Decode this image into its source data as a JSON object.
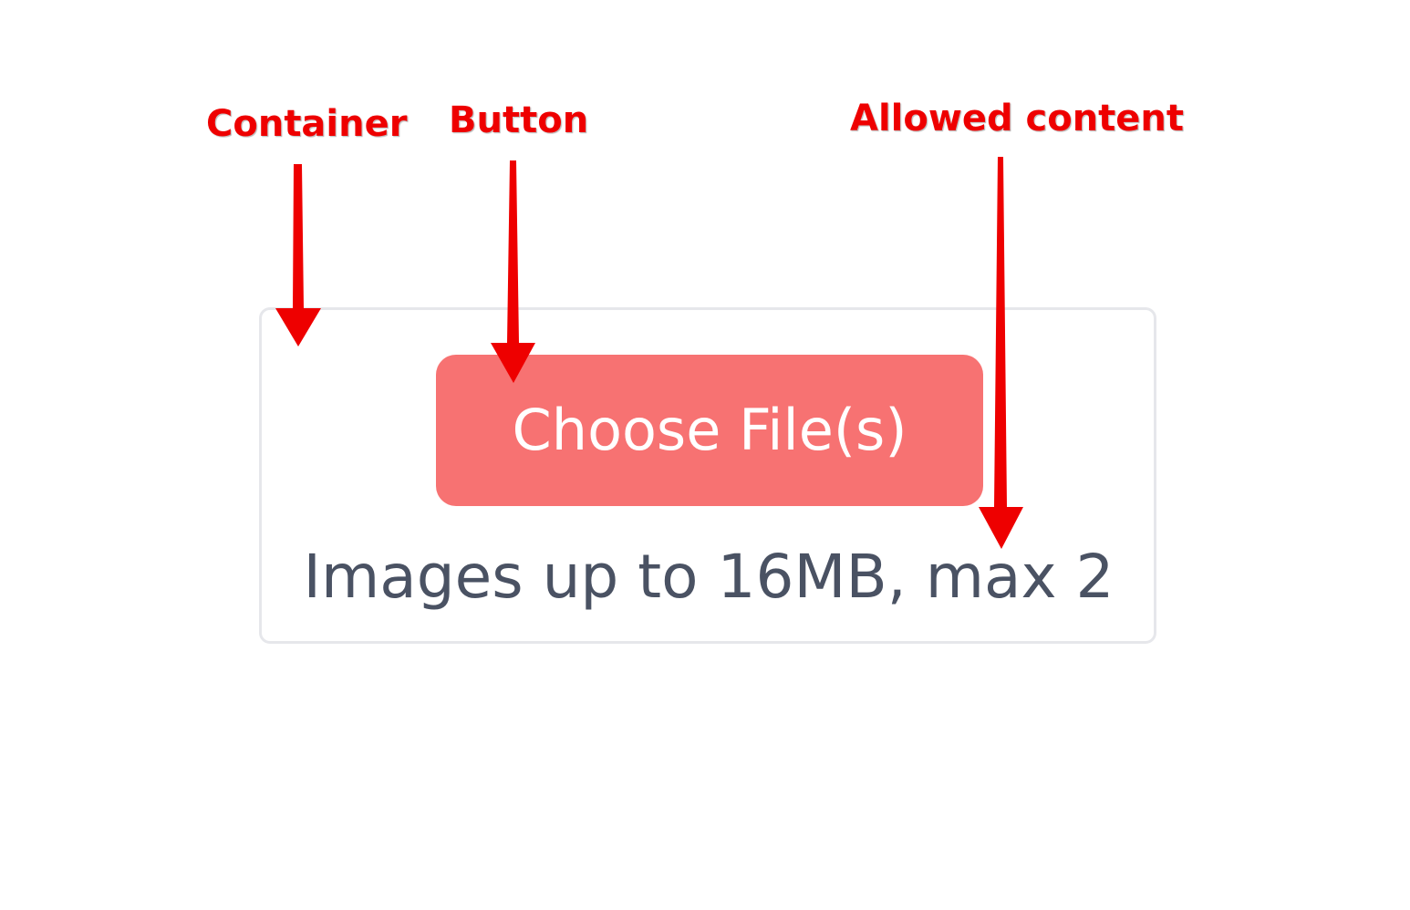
{
  "uploader": {
    "button_label": "Choose File(s)",
    "allowed_text": "Images up to 16MB, max 2"
  },
  "annotations": {
    "container_label": "Container",
    "button_label": "Button",
    "allowed_label": "Allowed content"
  },
  "colors": {
    "button_bg": "#f77272",
    "container_border": "#e6e7eb",
    "allowed_text": "#4a5263",
    "annotation": "#ee0000"
  }
}
